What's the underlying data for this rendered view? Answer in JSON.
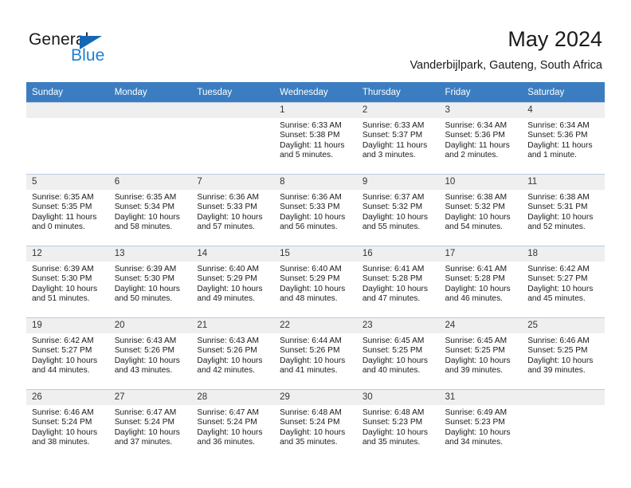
{
  "brand": {
    "name_part1": "General",
    "name_part2": "Blue",
    "logo_icon": "triangle-icon"
  },
  "header": {
    "month_title": "May 2024",
    "location": "Vanderbijlpark, Gauteng, South Africa"
  },
  "colors": {
    "header_row_bg": "#3b7dc0",
    "header_row_text": "#ffffff",
    "daynum_band_bg": "#efefef",
    "cell_border": "#b9cde2",
    "brand_blue": "#1c7fd4",
    "logo_triangle": "#1567b5",
    "text": "#1a1a1a"
  },
  "calendar": {
    "weekday_headers": [
      "Sunday",
      "Monday",
      "Tuesday",
      "Wednesday",
      "Thursday",
      "Friday",
      "Saturday"
    ],
    "labels": {
      "sunrise": "Sunrise:",
      "sunset": "Sunset:",
      "daylight": "Daylight:"
    },
    "weeks": [
      [
        {
          "day": "",
          "empty": true
        },
        {
          "day": "",
          "empty": true
        },
        {
          "day": "",
          "empty": true
        },
        {
          "day": "1",
          "sunrise": "Sunrise: 6:33 AM",
          "sunset": "Sunset: 5:38 PM",
          "daylight_line1": "Daylight: 11 hours",
          "daylight_line2": "and 5 minutes."
        },
        {
          "day": "2",
          "sunrise": "Sunrise: 6:33 AM",
          "sunset": "Sunset: 5:37 PM",
          "daylight_line1": "Daylight: 11 hours",
          "daylight_line2": "and 3 minutes."
        },
        {
          "day": "3",
          "sunrise": "Sunrise: 6:34 AM",
          "sunset": "Sunset: 5:36 PM",
          "daylight_line1": "Daylight: 11 hours",
          "daylight_line2": "and 2 minutes."
        },
        {
          "day": "4",
          "sunrise": "Sunrise: 6:34 AM",
          "sunset": "Sunset: 5:36 PM",
          "daylight_line1": "Daylight: 11 hours",
          "daylight_line2": "and 1 minute."
        }
      ],
      [
        {
          "day": "5",
          "sunrise": "Sunrise: 6:35 AM",
          "sunset": "Sunset: 5:35 PM",
          "daylight_line1": "Daylight: 11 hours",
          "daylight_line2": "and 0 minutes."
        },
        {
          "day": "6",
          "sunrise": "Sunrise: 6:35 AM",
          "sunset": "Sunset: 5:34 PM",
          "daylight_line1": "Daylight: 10 hours",
          "daylight_line2": "and 58 minutes."
        },
        {
          "day": "7",
          "sunrise": "Sunrise: 6:36 AM",
          "sunset": "Sunset: 5:33 PM",
          "daylight_line1": "Daylight: 10 hours",
          "daylight_line2": "and 57 minutes."
        },
        {
          "day": "8",
          "sunrise": "Sunrise: 6:36 AM",
          "sunset": "Sunset: 5:33 PM",
          "daylight_line1": "Daylight: 10 hours",
          "daylight_line2": "and 56 minutes."
        },
        {
          "day": "9",
          "sunrise": "Sunrise: 6:37 AM",
          "sunset": "Sunset: 5:32 PM",
          "daylight_line1": "Daylight: 10 hours",
          "daylight_line2": "and 55 minutes."
        },
        {
          "day": "10",
          "sunrise": "Sunrise: 6:38 AM",
          "sunset": "Sunset: 5:32 PM",
          "daylight_line1": "Daylight: 10 hours",
          "daylight_line2": "and 54 minutes."
        },
        {
          "day": "11",
          "sunrise": "Sunrise: 6:38 AM",
          "sunset": "Sunset: 5:31 PM",
          "daylight_line1": "Daylight: 10 hours",
          "daylight_line2": "and 52 minutes."
        }
      ],
      [
        {
          "day": "12",
          "sunrise": "Sunrise: 6:39 AM",
          "sunset": "Sunset: 5:30 PM",
          "daylight_line1": "Daylight: 10 hours",
          "daylight_line2": "and 51 minutes."
        },
        {
          "day": "13",
          "sunrise": "Sunrise: 6:39 AM",
          "sunset": "Sunset: 5:30 PM",
          "daylight_line1": "Daylight: 10 hours",
          "daylight_line2": "and 50 minutes."
        },
        {
          "day": "14",
          "sunrise": "Sunrise: 6:40 AM",
          "sunset": "Sunset: 5:29 PM",
          "daylight_line1": "Daylight: 10 hours",
          "daylight_line2": "and 49 minutes."
        },
        {
          "day": "15",
          "sunrise": "Sunrise: 6:40 AM",
          "sunset": "Sunset: 5:29 PM",
          "daylight_line1": "Daylight: 10 hours",
          "daylight_line2": "and 48 minutes."
        },
        {
          "day": "16",
          "sunrise": "Sunrise: 6:41 AM",
          "sunset": "Sunset: 5:28 PM",
          "daylight_line1": "Daylight: 10 hours",
          "daylight_line2": "and 47 minutes."
        },
        {
          "day": "17",
          "sunrise": "Sunrise: 6:41 AM",
          "sunset": "Sunset: 5:28 PM",
          "daylight_line1": "Daylight: 10 hours",
          "daylight_line2": "and 46 minutes."
        },
        {
          "day": "18",
          "sunrise": "Sunrise: 6:42 AM",
          "sunset": "Sunset: 5:27 PM",
          "daylight_line1": "Daylight: 10 hours",
          "daylight_line2": "and 45 minutes."
        }
      ],
      [
        {
          "day": "19",
          "sunrise": "Sunrise: 6:42 AM",
          "sunset": "Sunset: 5:27 PM",
          "daylight_line1": "Daylight: 10 hours",
          "daylight_line2": "and 44 minutes."
        },
        {
          "day": "20",
          "sunrise": "Sunrise: 6:43 AM",
          "sunset": "Sunset: 5:26 PM",
          "daylight_line1": "Daylight: 10 hours",
          "daylight_line2": "and 43 minutes."
        },
        {
          "day": "21",
          "sunrise": "Sunrise: 6:43 AM",
          "sunset": "Sunset: 5:26 PM",
          "daylight_line1": "Daylight: 10 hours",
          "daylight_line2": "and 42 minutes."
        },
        {
          "day": "22",
          "sunrise": "Sunrise: 6:44 AM",
          "sunset": "Sunset: 5:26 PM",
          "daylight_line1": "Daylight: 10 hours",
          "daylight_line2": "and 41 minutes."
        },
        {
          "day": "23",
          "sunrise": "Sunrise: 6:45 AM",
          "sunset": "Sunset: 5:25 PM",
          "daylight_line1": "Daylight: 10 hours",
          "daylight_line2": "and 40 minutes."
        },
        {
          "day": "24",
          "sunrise": "Sunrise: 6:45 AM",
          "sunset": "Sunset: 5:25 PM",
          "daylight_line1": "Daylight: 10 hours",
          "daylight_line2": "and 39 minutes."
        },
        {
          "day": "25",
          "sunrise": "Sunrise: 6:46 AM",
          "sunset": "Sunset: 5:25 PM",
          "daylight_line1": "Daylight: 10 hours",
          "daylight_line2": "and 39 minutes."
        }
      ],
      [
        {
          "day": "26",
          "sunrise": "Sunrise: 6:46 AM",
          "sunset": "Sunset: 5:24 PM",
          "daylight_line1": "Daylight: 10 hours",
          "daylight_line2": "and 38 minutes."
        },
        {
          "day": "27",
          "sunrise": "Sunrise: 6:47 AM",
          "sunset": "Sunset: 5:24 PM",
          "daylight_line1": "Daylight: 10 hours",
          "daylight_line2": "and 37 minutes."
        },
        {
          "day": "28",
          "sunrise": "Sunrise: 6:47 AM",
          "sunset": "Sunset: 5:24 PM",
          "daylight_line1": "Daylight: 10 hours",
          "daylight_line2": "and 36 minutes."
        },
        {
          "day": "29",
          "sunrise": "Sunrise: 6:48 AM",
          "sunset": "Sunset: 5:24 PM",
          "daylight_line1": "Daylight: 10 hours",
          "daylight_line2": "and 35 minutes."
        },
        {
          "day": "30",
          "sunrise": "Sunrise: 6:48 AM",
          "sunset": "Sunset: 5:23 PM",
          "daylight_line1": "Daylight: 10 hours",
          "daylight_line2": "and 35 minutes."
        },
        {
          "day": "31",
          "sunrise": "Sunrise: 6:49 AM",
          "sunset": "Sunset: 5:23 PM",
          "daylight_line1": "Daylight: 10 hours",
          "daylight_line2": "and 34 minutes."
        },
        {
          "day": "",
          "empty": true
        }
      ]
    ]
  }
}
